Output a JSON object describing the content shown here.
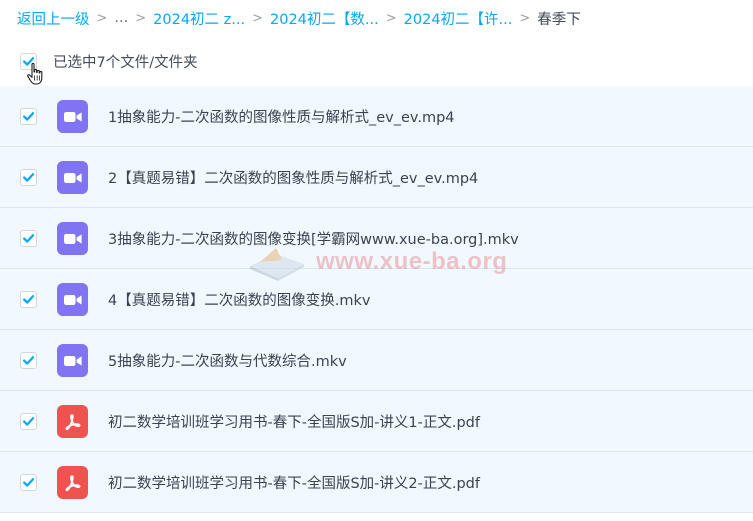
{
  "breadcrumb": {
    "back": "返回上一级",
    "ellipsis": "...",
    "sep": ">",
    "crumb_1": "2024初二 z...",
    "crumb_2": "2024初二【数...",
    "crumb_3": "2024初二【许...",
    "current": "春季下"
  },
  "selection": {
    "label": "已选中7个文件/文件夹",
    "checked": true
  },
  "files": [
    {
      "name": "1抽象能力-二次函数的图像性质与解析式_ev_ev.mp4",
      "type": "video",
      "checked": true
    },
    {
      "name": "2【真题易错】二次函数的图象性质与解析式_ev_ev.mp4",
      "type": "video",
      "checked": true
    },
    {
      "name": "3抽象能力-二次函数的图像变换[学霸网www.xue-ba.org].mkv",
      "type": "video",
      "checked": true
    },
    {
      "name": "4【真题易错】二次函数的图像变换.mkv",
      "type": "video",
      "checked": true
    },
    {
      "name": "5抽象能力-二次函数与代数综合.mkv",
      "type": "video",
      "checked": true
    },
    {
      "name": "初二数学培训班学习用书-春下-全国版S加-讲义1-正文.pdf",
      "type": "pdf",
      "checked": true
    },
    {
      "name": "初二数学培训班学习用书-春下-全国版S加-讲义2-正文.pdf",
      "type": "pdf",
      "checked": true
    }
  ],
  "watermark": {
    "text": "www.xue-ba.org"
  },
  "colors": {
    "link": "#06a7ff",
    "check": "#06a7ff",
    "row_bg": "#f1f8ff",
    "video_icon": "#7f75f2",
    "pdf_icon": "#ef5350"
  }
}
